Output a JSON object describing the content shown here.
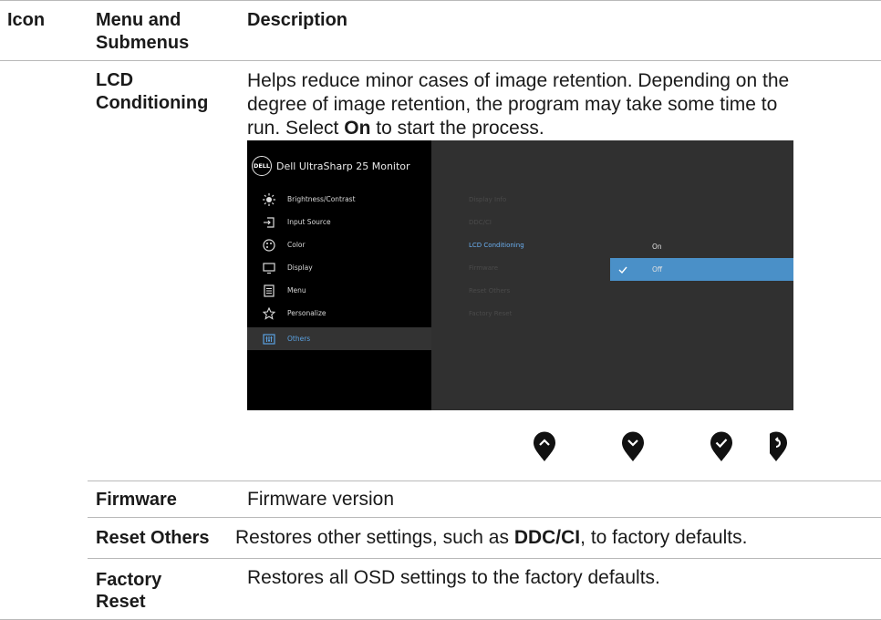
{
  "table": {
    "headers": {
      "icon": "Icon",
      "menu_line1": "Menu and",
      "menu_line2": "Submenus",
      "description": "Description"
    },
    "rows": [
      {
        "menu_line1": "LCD",
        "menu_line2": "Conditioning",
        "desc_line1": "Helps reduce minor cases of image retention. Depending on the",
        "desc_line2": "degree of image retention, the program may take some time to",
        "desc_line3_pre": "run. Select ",
        "desc_line3_bold": "On",
        "desc_line3_post": " to start the process."
      },
      {
        "menu": "Firmware",
        "desc": "Firmware version"
      },
      {
        "menu": "Reset Others",
        "desc_pre": "Restores other settings, such as ",
        "desc_bold": "DDC/CI",
        "desc_post": ", to factory defaults."
      },
      {
        "menu_line1": "Factory",
        "menu_line2": "Reset",
        "desc": "Restores all OSD settings to the factory defaults."
      }
    ]
  },
  "osd": {
    "logo_text": "DELL",
    "title": "Dell UltraSharp 25 Monitor",
    "menu": [
      {
        "label": "Brightness/Contrast",
        "icon": "brightness-icon"
      },
      {
        "label": "Input Source",
        "icon": "input-source-icon"
      },
      {
        "label": "Color",
        "icon": "color-icon"
      },
      {
        "label": "Display",
        "icon": "display-icon"
      },
      {
        "label": "Menu",
        "icon": "menu-icon"
      },
      {
        "label": "Personalize",
        "icon": "star-icon"
      },
      {
        "label": "Others",
        "icon": "others-icon"
      }
    ],
    "active_menu": "Others",
    "submenu": [
      "Display Info",
      "DDC/CI",
      "LCD Conditioning",
      "Firmware",
      "Reset Others",
      "Factory Reset"
    ],
    "active_submenu": "LCD Conditioning",
    "options": [
      {
        "label": "On",
        "selected": false
      },
      {
        "label": "Off",
        "selected": true
      }
    ],
    "colors": {
      "panel_bg": "#303030",
      "menu_bg": "#000000",
      "accent": "#4a90c8",
      "active_text": "#5aa0e0"
    }
  },
  "nav_buttons": [
    "up-button-icon",
    "down-button-icon",
    "confirm-button-icon",
    "back-button-icon"
  ]
}
